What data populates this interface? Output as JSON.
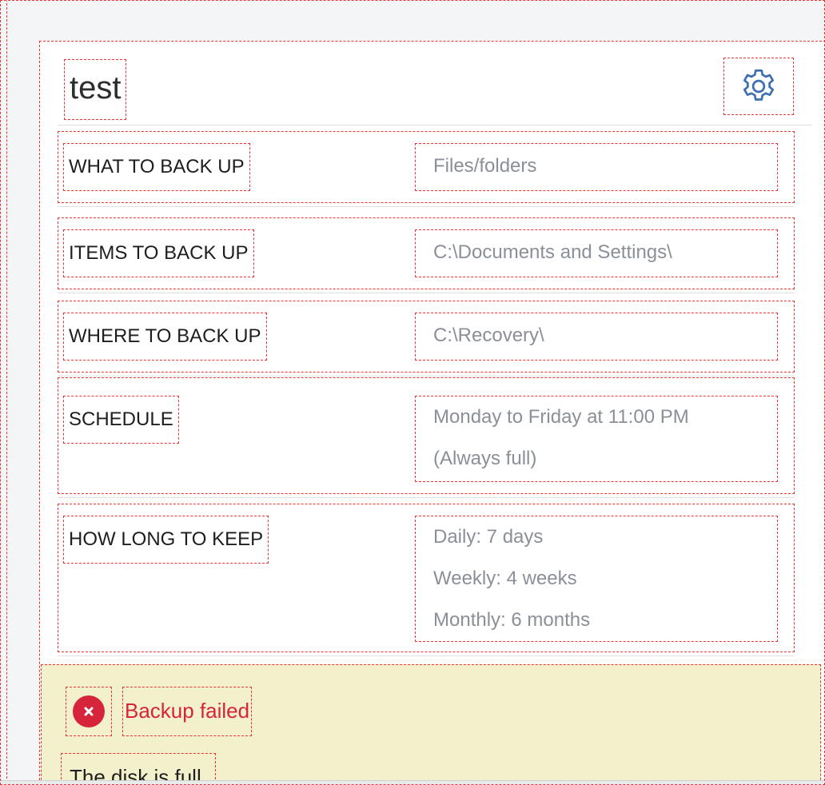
{
  "plan": {
    "title": "test",
    "settings_icon": "gear-icon"
  },
  "rows": [
    {
      "label": "WHAT TO BACK UP",
      "values": [
        "Files/folders"
      ]
    },
    {
      "label": "ITEMS TO BACK UP",
      "values": [
        "C:\\Documents and Settings\\"
      ]
    },
    {
      "label": "WHERE TO BACK UP",
      "values": [
        "C:\\Recovery\\"
      ]
    },
    {
      "label": "SCHEDULE",
      "values": [
        "Monday to Friday at 11:00 PM",
        "(Always full)"
      ]
    },
    {
      "label": "HOW LONG TO KEEP",
      "values": [
        "Daily: 7 days",
        "Weekly: 4 weeks",
        "Monthly: 6 months"
      ]
    }
  ],
  "status": {
    "icon": "error-icon",
    "title": "Backup failed",
    "message": "The disk is full.",
    "colors": {
      "error": "#d6243b",
      "background": "#f3f1cc"
    }
  },
  "colors": {
    "accent": "#3d6fb0",
    "value_text": "#8a8f98"
  }
}
